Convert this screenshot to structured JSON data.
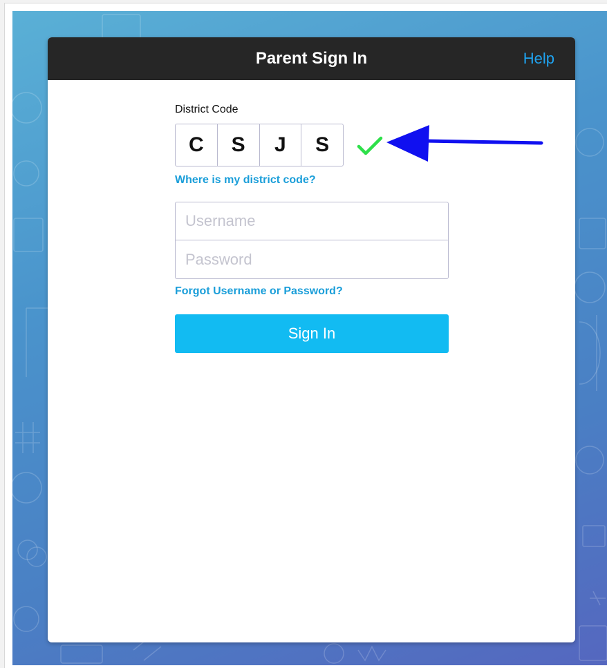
{
  "header": {
    "title": "Parent Sign In",
    "help_label": "Help"
  },
  "district": {
    "label": "District Code",
    "code": [
      "C",
      "S",
      "J",
      "S"
    ],
    "status_icon": "checkmark-icon",
    "status_color": "#2ee04a",
    "help_link": "Where is my district code?"
  },
  "annotation": {
    "icon": "arrow-left-icon",
    "color": "#1010f0"
  },
  "credentials": {
    "username_placeholder": "Username",
    "username_value": "",
    "password_placeholder": "Password",
    "password_value": "",
    "forgot_link": "Forgot Username or Password?"
  },
  "actions": {
    "signin_label": "Sign In",
    "signin_color": "#12bbf2"
  },
  "colors": {
    "header_bg": "#262626",
    "link": "#1a9ed9",
    "background_gradient_start": "#5ab0d6",
    "background_gradient_end": "#5567bf"
  }
}
